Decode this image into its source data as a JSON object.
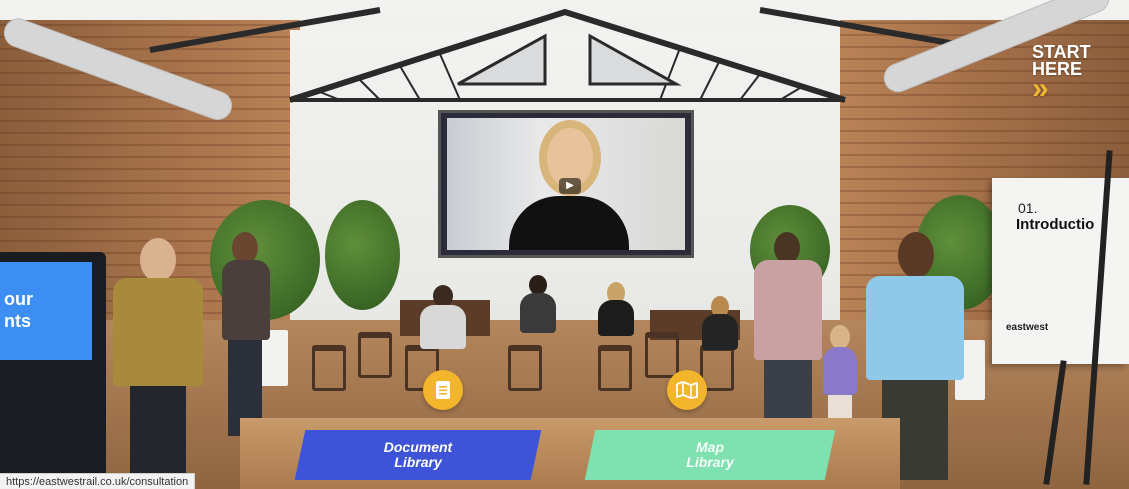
{
  "start_here": {
    "label_line1": "START",
    "label_line2": "HERE",
    "chevrons": "»"
  },
  "board": {
    "number": "01.",
    "title": "Introductio",
    "logo": "eastwest"
  },
  "kiosk": {
    "line1": "our",
    "line2": "nts"
  },
  "pads": {
    "document": {
      "line1": "Document",
      "line2": "Library"
    },
    "map": {
      "line1": "Map",
      "line2": "Library"
    }
  },
  "status_bar": {
    "url": "https://eastwestrail.co.uk/consultation"
  },
  "icons": {
    "document_button": "document-icon",
    "map_button": "map-icon",
    "video_play": "play-icon"
  },
  "colors": {
    "accent_yellow": "#f3b52b",
    "document_pad": "#3d53d8",
    "map_pad": "#7fe0b0",
    "kiosk_screen": "#3d8ef2"
  }
}
